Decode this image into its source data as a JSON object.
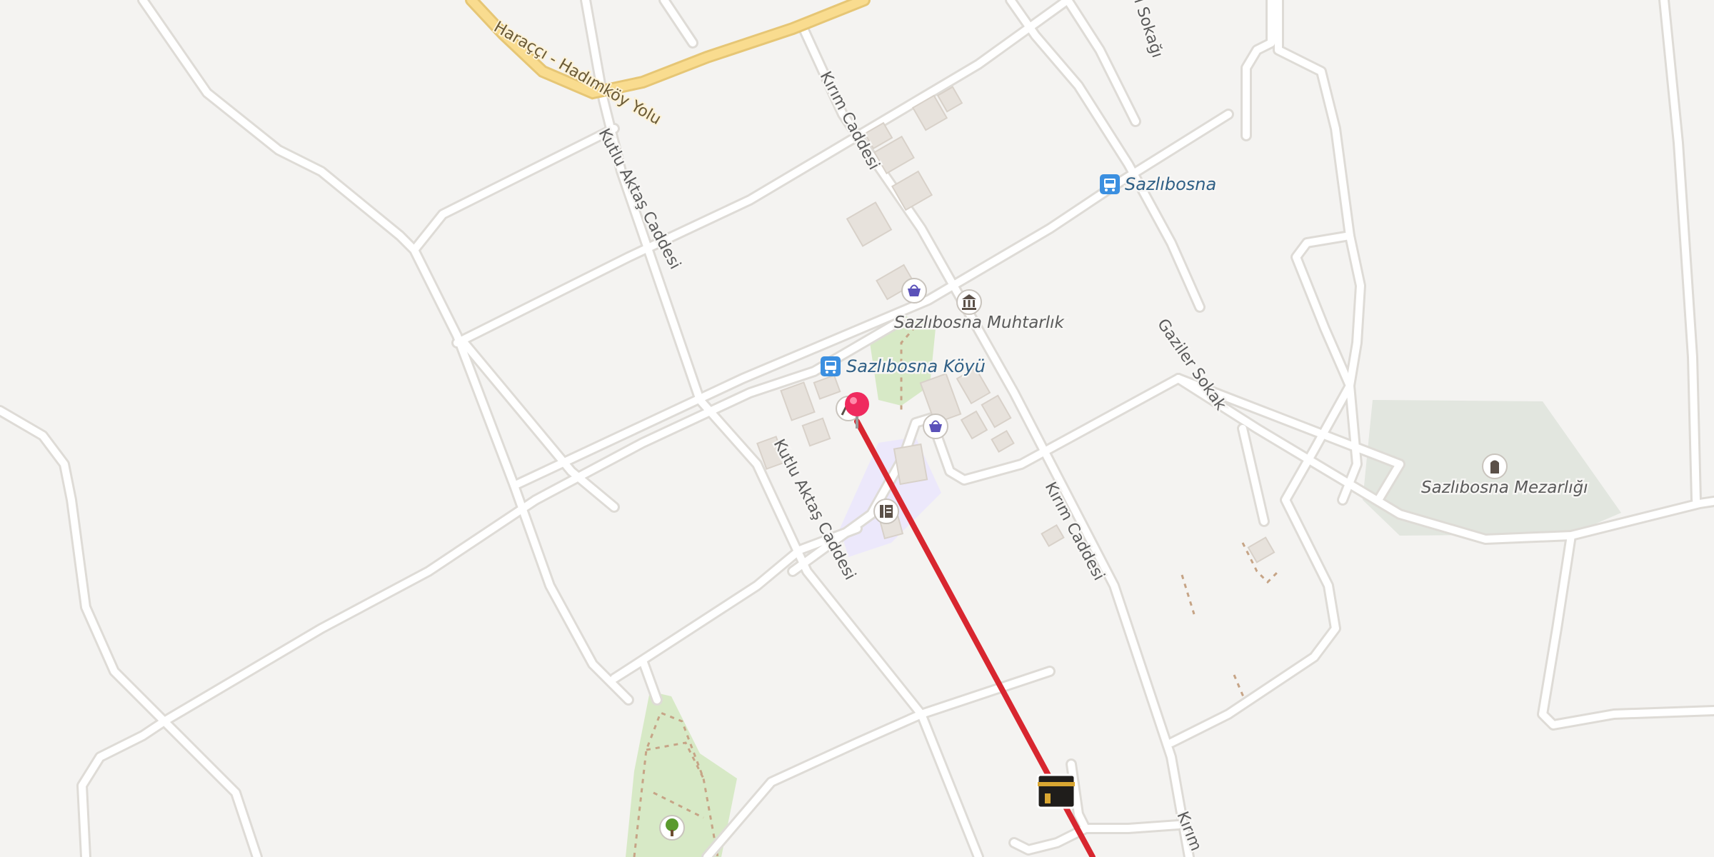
{
  "map": {
    "colors": {
      "background": "#f4f3f1",
      "road": "#ffffff",
      "major_road": "#f9dc8f",
      "park": "#d7e9c6",
      "cemetery": "#e2e6df",
      "school": "#ece8fb",
      "route": "#d8262f",
      "pin": "#ef2a5e",
      "transit": "#3b8fe0",
      "shop_icon": "#5a51b9"
    },
    "streets": {
      "haracci": "Haraççı - Hadımköy Yolu",
      "kutlu_north": "Kutlu Aktaş Caddesi",
      "kutlu_south": "Kutlu Aktaş Caddesi",
      "kirim_north": "Kırım Caddesi",
      "kirim_mid": "Kırım Caddesi",
      "kirim_south": "Kırım",
      "gazi": "Gaziler Sokak",
      "top_sokak": "l Sokağı"
    },
    "places": {
      "muhtarlik": "Sazlıbosna Muhtarlık",
      "koyu_stop": "Sazlıbosna Köyü",
      "sazlibosna_stop": "Sazlıbosna",
      "cemetery": "Sazlıbosna Mezarlığı"
    },
    "icons": [
      "shopping-basket-icon",
      "town-hall-icon",
      "bus-stop-icon",
      "park-tree-icon",
      "cemetery-icon",
      "school-icon",
      "kaaba-icon",
      "location-pin-icon"
    ]
  }
}
